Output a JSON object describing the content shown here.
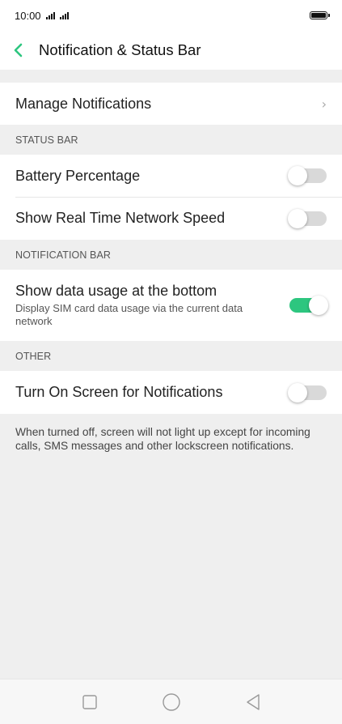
{
  "status_bar": {
    "time": "10:00"
  },
  "header": {
    "title": "Notification & Status Bar"
  },
  "manage": {
    "label": "Manage Notifications"
  },
  "sections": {
    "status_bar": "STATUS BAR",
    "notification_bar": "NOTIFICATION BAR",
    "other": "OTHER"
  },
  "settings": {
    "battery_percentage": {
      "label": "Battery Percentage",
      "enabled": false
    },
    "network_speed": {
      "label": "Show Real Time Network Speed",
      "enabled": false
    },
    "data_usage": {
      "label": "Show data usage at the bottom",
      "description": "Display SIM card data usage via the current data network",
      "enabled": true
    },
    "screen_on": {
      "label": "Turn On Screen for Notifications",
      "enabled": false
    }
  },
  "footnote": "When turned off, screen will not light up except for incoming calls, SMS messages and other lockscreen notifications.",
  "colors": {
    "accent": "#2dc67f",
    "toggle_off": "#d9d9d9",
    "background": "#efefef"
  }
}
